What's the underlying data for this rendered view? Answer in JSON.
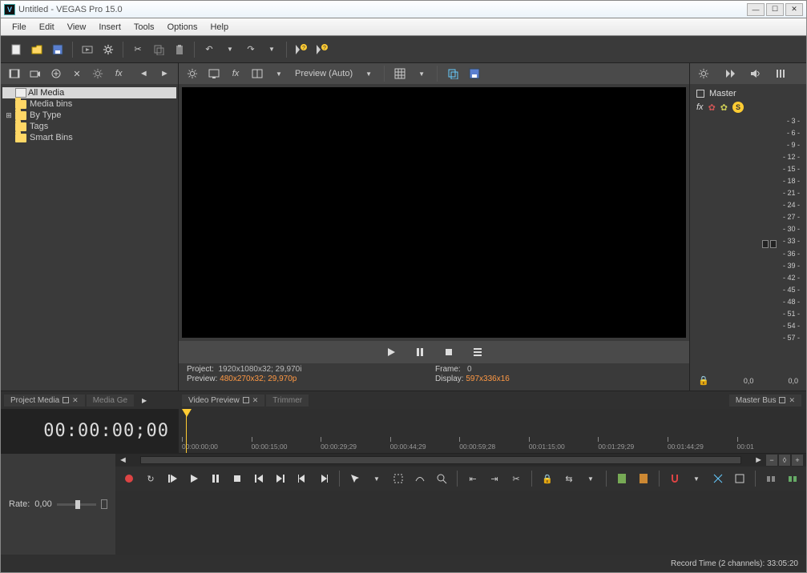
{
  "window": {
    "title": "Untitled - VEGAS Pro 15.0"
  },
  "menu": {
    "file": "File",
    "edit": "Edit",
    "view": "View",
    "insert": "Insert",
    "tools": "Tools",
    "options": "Options",
    "help": "Help"
  },
  "tree": {
    "items": [
      {
        "label": "All Media",
        "icon": "film",
        "selected": true
      },
      {
        "label": "Media bins",
        "icon": "folder"
      },
      {
        "label": "By Type",
        "icon": "folder",
        "expandable": true
      },
      {
        "label": "Tags",
        "icon": "folder"
      },
      {
        "label": "Smart Bins",
        "icon": "folder"
      }
    ]
  },
  "preview": {
    "mode_label": "Preview (Auto)",
    "info": {
      "project_k": "Project:",
      "project_v": "1920x1080x32; 29,970i",
      "preview_k": "Preview:",
      "preview_v": "480x270x32; 29,970p",
      "frame_k": "Frame:",
      "frame_v": "0",
      "display_k": "Display:",
      "display_v": "597x336x16"
    }
  },
  "master": {
    "label": "Master",
    "scale": [
      "- 3 -",
      "- 6 -",
      "- 9 -",
      "- 12 -",
      "- 15 -",
      "- 18 -",
      "- 21 -",
      "- 24 -",
      "- 27 -",
      "- 30 -",
      "- 33 -",
      "- 36 -",
      "- 39 -",
      "- 42 -",
      "- 45 -",
      "- 48 -",
      "- 51 -",
      "- 54 -",
      "- 57 -"
    ],
    "level_l": "0,0",
    "level_r": "0,0"
  },
  "tabs": {
    "project_media": "Project Media",
    "media_gen": "Media Ge",
    "video_preview": "Video Preview",
    "trimmer": "Trimmer",
    "master_bus": "Master Bus"
  },
  "timeline": {
    "timecode": "00:00:00;00",
    "rate_label": "Rate:",
    "rate_value": "0,00",
    "ticks": [
      "00:00:00;00",
      "00:00:15;00",
      "00:00:29;29",
      "00:00:44;29",
      "00:00:59;28",
      "00:01:15;00",
      "00:01:29;29",
      "00:01:44;29",
      "00:01"
    ]
  },
  "status": {
    "record": "Record Time (2 channels): 33:05:20"
  }
}
